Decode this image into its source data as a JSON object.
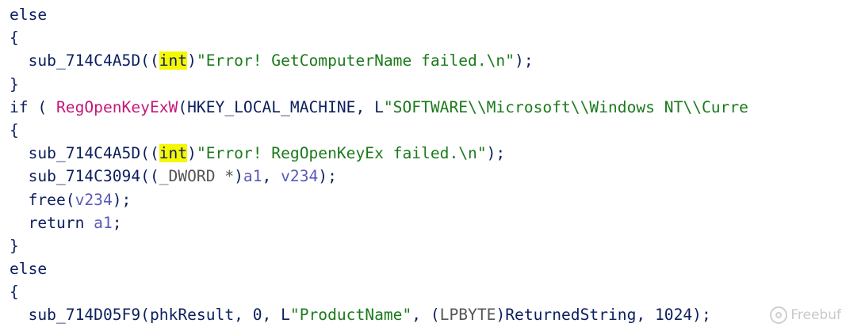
{
  "lines": [
    {
      "indent": "",
      "tokens": [
        {
          "t": "else",
          "c": "kw"
        }
      ]
    },
    {
      "indent": "",
      "tokens": [
        {
          "t": "{",
          "c": "kw"
        }
      ]
    },
    {
      "indent": "  ",
      "tokens": [
        {
          "t": "sub_714C4A5D((",
          "c": "kw"
        },
        {
          "t": "int",
          "c": "kw hl"
        },
        {
          "t": ")",
          "c": "kw"
        },
        {
          "t": "\"Error! GetComputerName failed.\\n\"",
          "c": "str"
        },
        {
          "t": ");",
          "c": "kw"
        }
      ]
    },
    {
      "indent": "",
      "tokens": [
        {
          "t": "}",
          "c": "kw"
        }
      ]
    },
    {
      "indent": "",
      "tokens": [
        {
          "t": "if ( ",
          "c": "kw"
        },
        {
          "t": "RegOpenKeyExW",
          "c": "fn-red"
        },
        {
          "t": "(HKEY_LOCAL_MACHINE, L",
          "c": "kw"
        },
        {
          "t": "\"SOFTWARE\\\\Microsoft\\\\Windows NT\\\\Curre",
          "c": "str"
        }
      ]
    },
    {
      "indent": "",
      "tokens": [
        {
          "t": "{",
          "c": "kw"
        }
      ]
    },
    {
      "indent": "  ",
      "tokens": [
        {
          "t": "sub_714C4A5D((",
          "c": "kw"
        },
        {
          "t": "int",
          "c": "kw hl"
        },
        {
          "t": ")",
          "c": "kw"
        },
        {
          "t": "\"Error! RegOpenKeyEx failed.\\n\"",
          "c": "str"
        },
        {
          "t": ");",
          "c": "kw"
        }
      ]
    },
    {
      "indent": "  ",
      "tokens": [
        {
          "t": "sub_714C3094((",
          "c": "kw"
        },
        {
          "t": "_DWORD *",
          "c": "gray"
        },
        {
          "t": ")",
          "c": "kw"
        },
        {
          "t": "a1",
          "c": "var"
        },
        {
          "t": ", ",
          "c": "kw"
        },
        {
          "t": "v234",
          "c": "var"
        },
        {
          "t": ");",
          "c": "kw"
        }
      ]
    },
    {
      "indent": "  ",
      "tokens": [
        {
          "t": "free(",
          "c": "kw"
        },
        {
          "t": "v234",
          "c": "var"
        },
        {
          "t": ");",
          "c": "kw"
        }
      ]
    },
    {
      "indent": "  ",
      "tokens": [
        {
          "t": "return ",
          "c": "kw"
        },
        {
          "t": "a1",
          "c": "var"
        },
        {
          "t": ";",
          "c": "kw"
        }
      ]
    },
    {
      "indent": "",
      "tokens": [
        {
          "t": "}",
          "c": "kw"
        }
      ]
    },
    {
      "indent": "",
      "tokens": [
        {
          "t": "else",
          "c": "kw"
        }
      ]
    },
    {
      "indent": "",
      "tokens": [
        {
          "t": "{",
          "c": "kw"
        }
      ]
    },
    {
      "indent": "  ",
      "tokens": [
        {
          "t": "sub_714D05F9(phkResult, 0, L",
          "c": "kw"
        },
        {
          "t": "\"ProductName\"",
          "c": "str"
        },
        {
          "t": ", (",
          "c": "kw"
        },
        {
          "t": "LPBYTE",
          "c": "gray"
        },
        {
          "t": ")ReturnedString, 1024);",
          "c": "kw"
        }
      ]
    }
  ],
  "watermark": {
    "text": "Freebuf",
    "icon": "freebuf-logo-icon"
  }
}
